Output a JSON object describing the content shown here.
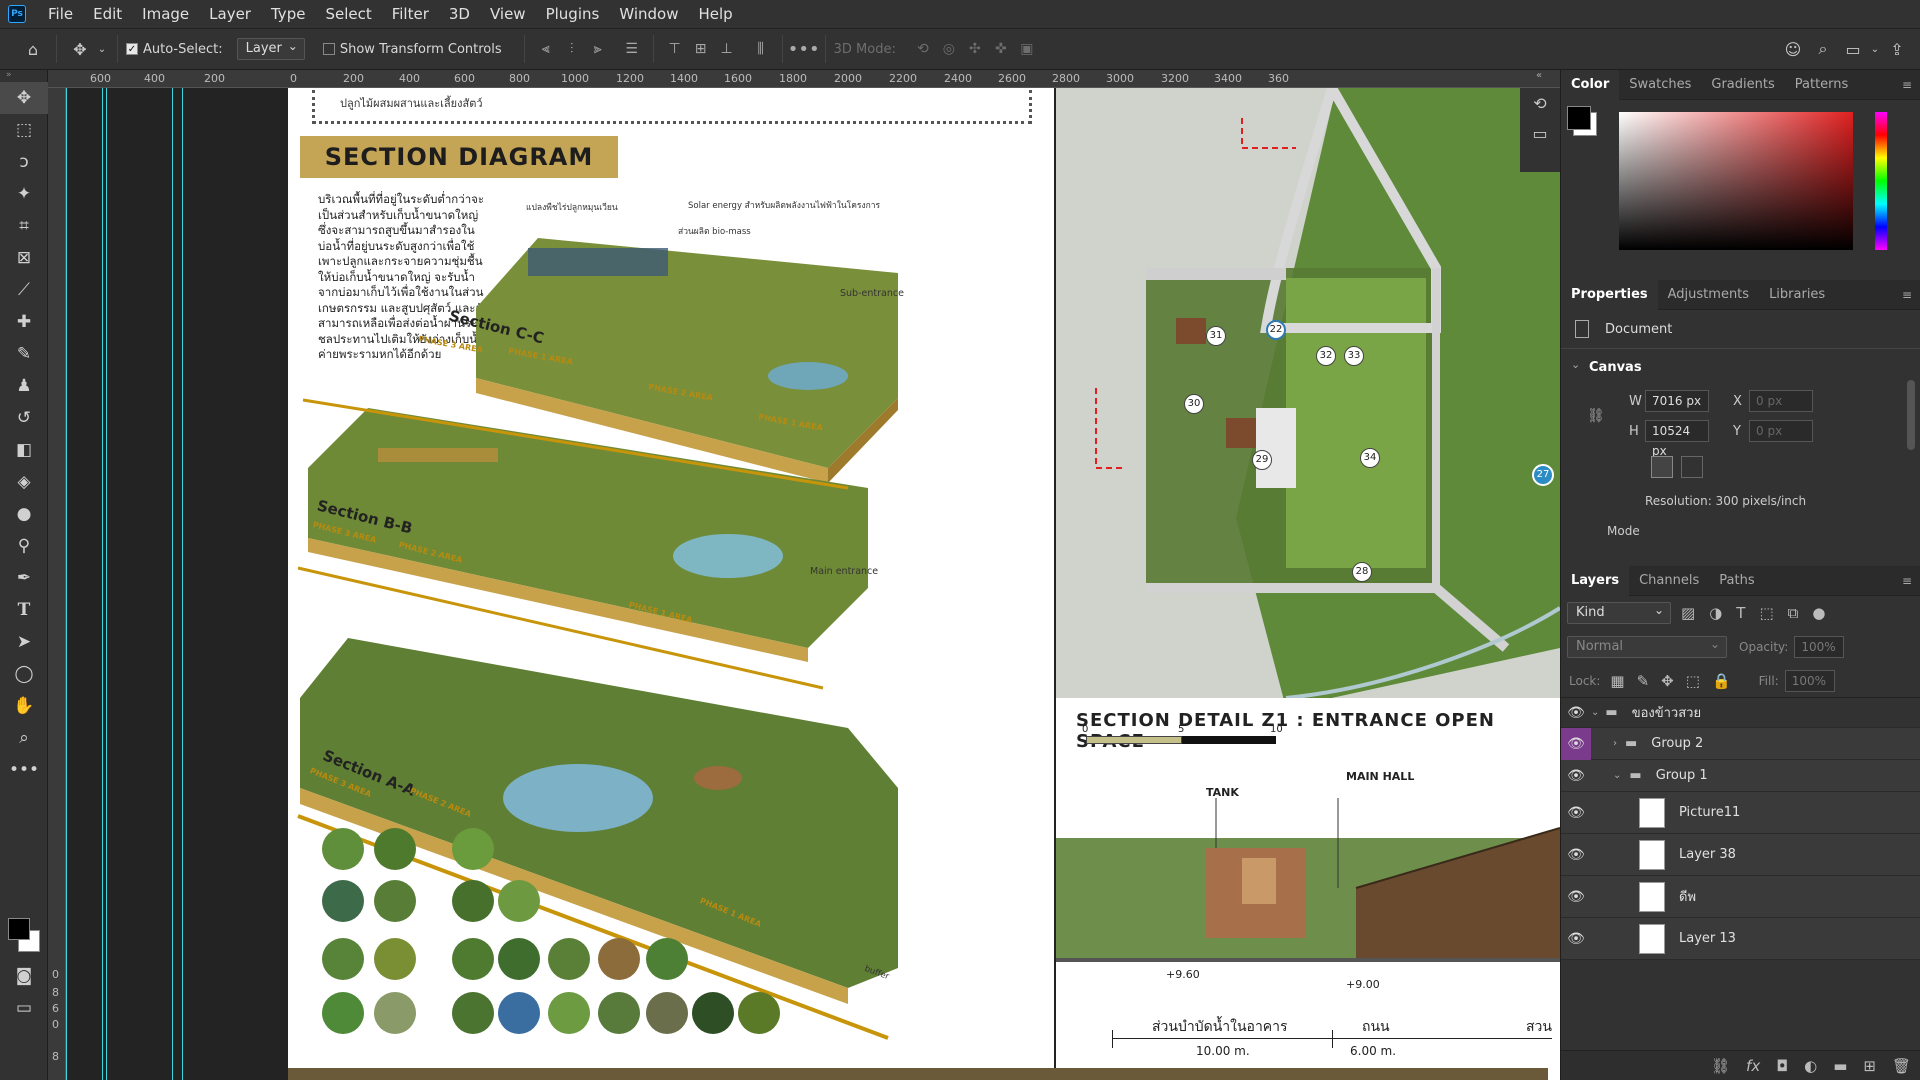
{
  "app": {
    "logo": "Ps"
  },
  "menu": [
    "File",
    "Edit",
    "Image",
    "Layer",
    "Type",
    "Select",
    "Filter",
    "3D",
    "View",
    "Plugins",
    "Window",
    "Help"
  ],
  "options": {
    "auto_select_label": "Auto-Select:",
    "auto_select_value": "Layer",
    "show_transform_label": "Show Transform Controls",
    "mode_3d_label": "3D Mode:"
  },
  "ruler_ticks": [
    "600",
    "400",
    "200",
    "0",
    "200",
    "400",
    "600",
    "800",
    "1000",
    "1200",
    "1400",
    "1600",
    "1800",
    "2000",
    "2200",
    "2400",
    "2600",
    "2800",
    "3000",
    "3200",
    "3400",
    "360"
  ],
  "document": {
    "title": "SECTION DIAGRAM",
    "top_note": "ปลูกไม้ผสมผสานและเลี้ยงสัตว์",
    "body_text": "บริเวณพื้นที่ที่อยู่ในระดับต่ำกว่าจะเป็นส่วนสำหรับเก็บน้ำขนาดใหญ่ ซึ่งจะสามารถสูบขึ้นมาสำรองในบ่อน้ำที่อยู่บนระดับสูงกว่าเพื่อใช้เพาะปลูกและกระจายความชุ่มชื้นให้บ่อเก็บน้ำขนาดใหญ่ จะรับน้ำจากบ่อมาเก็บไว้เพื่อใช้งานในส่วนเกษตรกรรม และสูบปศุสัตว์ และยังสามารถเหลือเพื่อส่งต่อน้ำผ่านระบบชลประทานไปเติมให้ยังอ่างเก็บน้ำค่ายพระรามหกได้อีกด้วย",
    "sections": [
      "Section C-C",
      "Section B-B",
      "Section A-A"
    ],
    "phases": [
      "PHASE 3 AREA",
      "PHASE 1 AREA",
      "PHASE 2 AREA",
      "PHASE 1 AREA"
    ],
    "notes": {
      "solar": "Solar energy สำหรับผลิตพลังงานไฟฟ้าในโครงการ",
      "sub_entrance": "Sub-entrance",
      "main_entrance": "Main entrance",
      "buffer": "buffer",
      "bio": "ส่วนผลิต bio-mass",
      "planting": "แปลงพืชไร่ปลูกหมุนเวียน"
    },
    "detail_title": "SECTION DETAIL Z1 : ENTRANCE OPEN SPACE",
    "scale": [
      "0",
      "5",
      "10"
    ],
    "labels": {
      "tank": "TANK",
      "main_hall": "MAIN HALL"
    },
    "levels": [
      "+9.60",
      "+9.00"
    ],
    "bottom_thai_1": "ส่วนบำบัดน้ำในอาคาร",
    "bottom_thai_2": "ถนน",
    "bottom_thai_3": "สวน",
    "dims": [
      "10.00 m.",
      "6.00 m."
    ],
    "plan_numbers": [
      "31",
      "22",
      "32",
      "33",
      "30",
      "29",
      "34",
      "28",
      "27"
    ]
  },
  "color_panel": {
    "tabs": [
      "Color",
      "Swatches",
      "Gradients",
      "Patterns"
    ]
  },
  "properties": {
    "tabs": [
      "Properties",
      "Adjustments",
      "Libraries"
    ],
    "document_label": "Document",
    "canvas_label": "Canvas",
    "w_label": "W",
    "w_value": "7016 px",
    "h_label": "H",
    "h_value": "10524 px",
    "x_label": "X",
    "x_placeholder": "0 px",
    "y_label": "Y",
    "y_placeholder": "0 px",
    "resolution": "Resolution: 300 pixels/inch",
    "mode_label": "Mode"
  },
  "layers": {
    "tabs": [
      "Layers",
      "Channels",
      "Paths"
    ],
    "kind": "Kind",
    "blend": "Normal",
    "opacity_label": "Opacity:",
    "opacity_value": "100%",
    "lock_label": "Lock:",
    "fill_label": "Fill:",
    "fill_value": "100%",
    "items": [
      {
        "name": "ของข้าวสวย"
      },
      {
        "name": "Group 2"
      },
      {
        "name": "Group 1"
      },
      {
        "name": "Picture11"
      },
      {
        "name": "Layer 38"
      },
      {
        "name": "ดีพ"
      },
      {
        "name": "Layer 13"
      }
    ]
  },
  "left_ruler": [
    "0",
    "8",
    "6",
    "0",
    "8"
  ]
}
